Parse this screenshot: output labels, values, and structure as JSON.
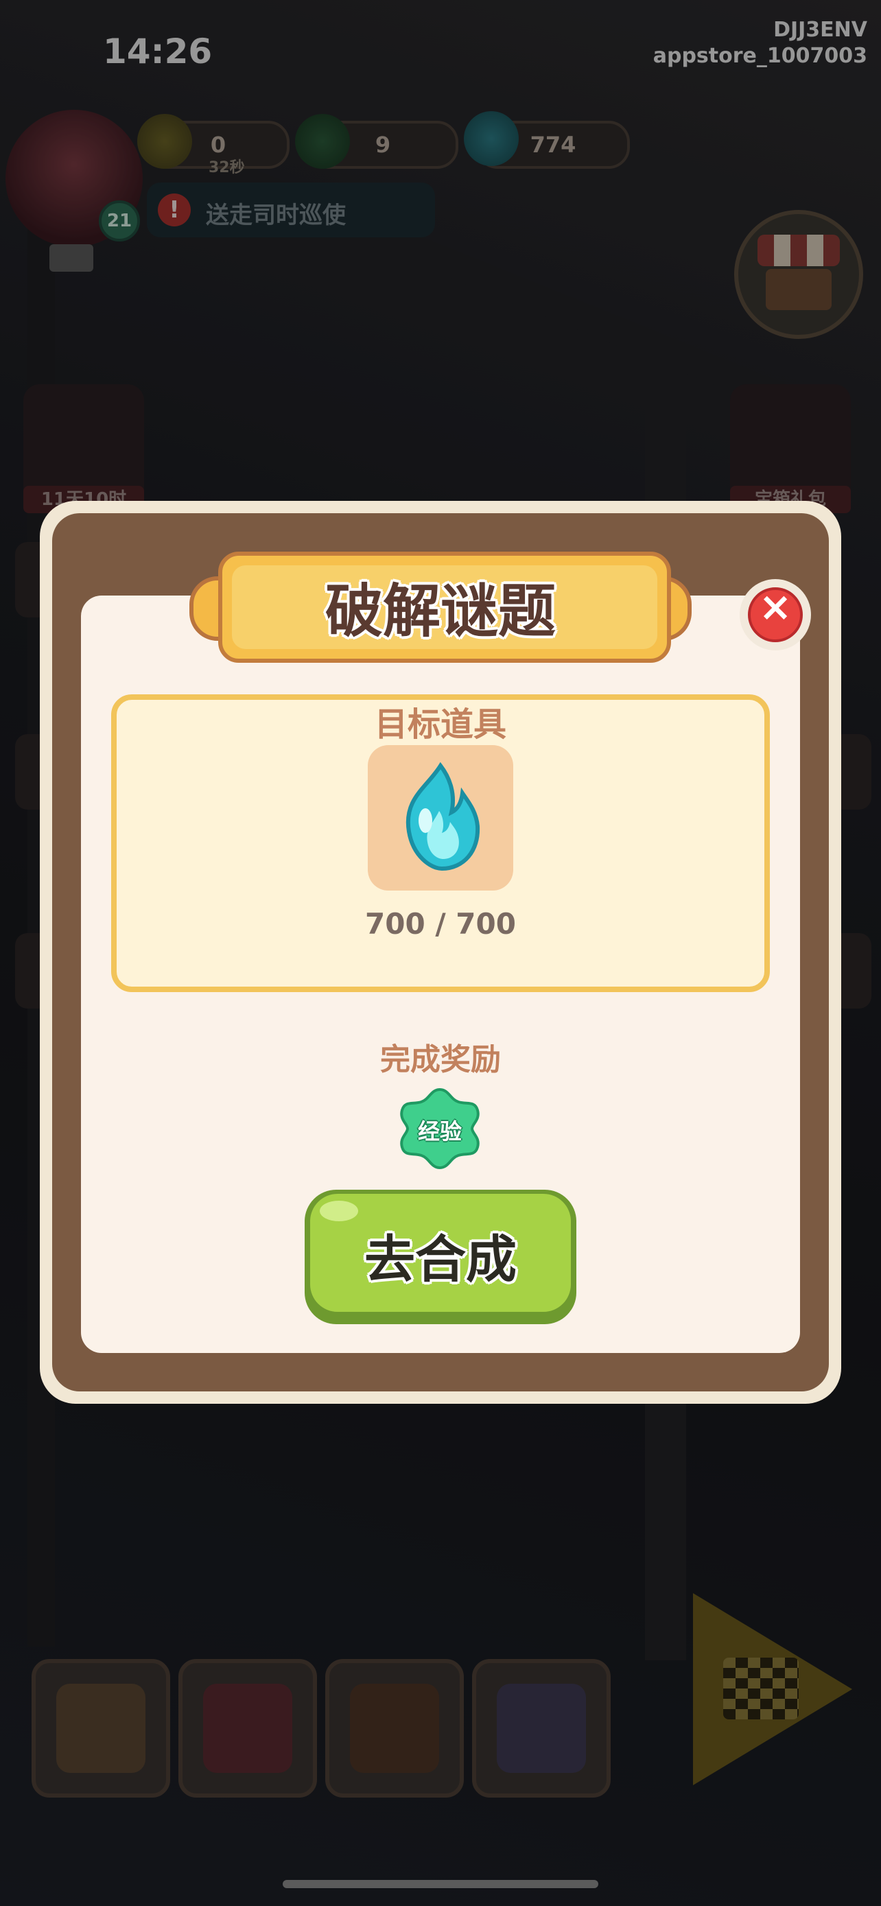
{
  "status_bar": {
    "time": "14:26",
    "device_id": "DJJ3ENV",
    "channel": "appstore_1007003"
  },
  "hud": {
    "level": "21",
    "resources": [
      {
        "icon": "energy-bolt-icon",
        "value": "0",
        "sub": "32秒"
      },
      {
        "icon": "jade-coin-icon",
        "value": "9"
      },
      {
        "icon": "blue-flame-icon",
        "value": "774"
      }
    ],
    "quest_text": "送走司时巡使",
    "side_left_label": "11天10时",
    "side_right_label": "宝箱礼包"
  },
  "modal": {
    "title": "破解谜题",
    "target_heading": "目标道具",
    "target_item_icon": "blue-flame-icon",
    "progress": "700 / 700",
    "reward_heading": "完成奖励",
    "reward_label": "经验",
    "action_label": "去合成",
    "close_icon": "close-icon"
  },
  "bottom_nav": [
    {
      "icon": "home-icon"
    },
    {
      "icon": "book-icon"
    },
    {
      "icon": "pushpin-icon"
    },
    {
      "icon": "cards-icon"
    },
    {
      "icon": "board-icon"
    }
  ],
  "colors": {
    "modal_frame": "#7b5a42",
    "modal_bg": "#fbf2e9",
    "title_plaque": "#f6c04c",
    "close_red": "#e8423e",
    "action_green": "#a6d245",
    "reward_green": "#3fcf8c"
  }
}
